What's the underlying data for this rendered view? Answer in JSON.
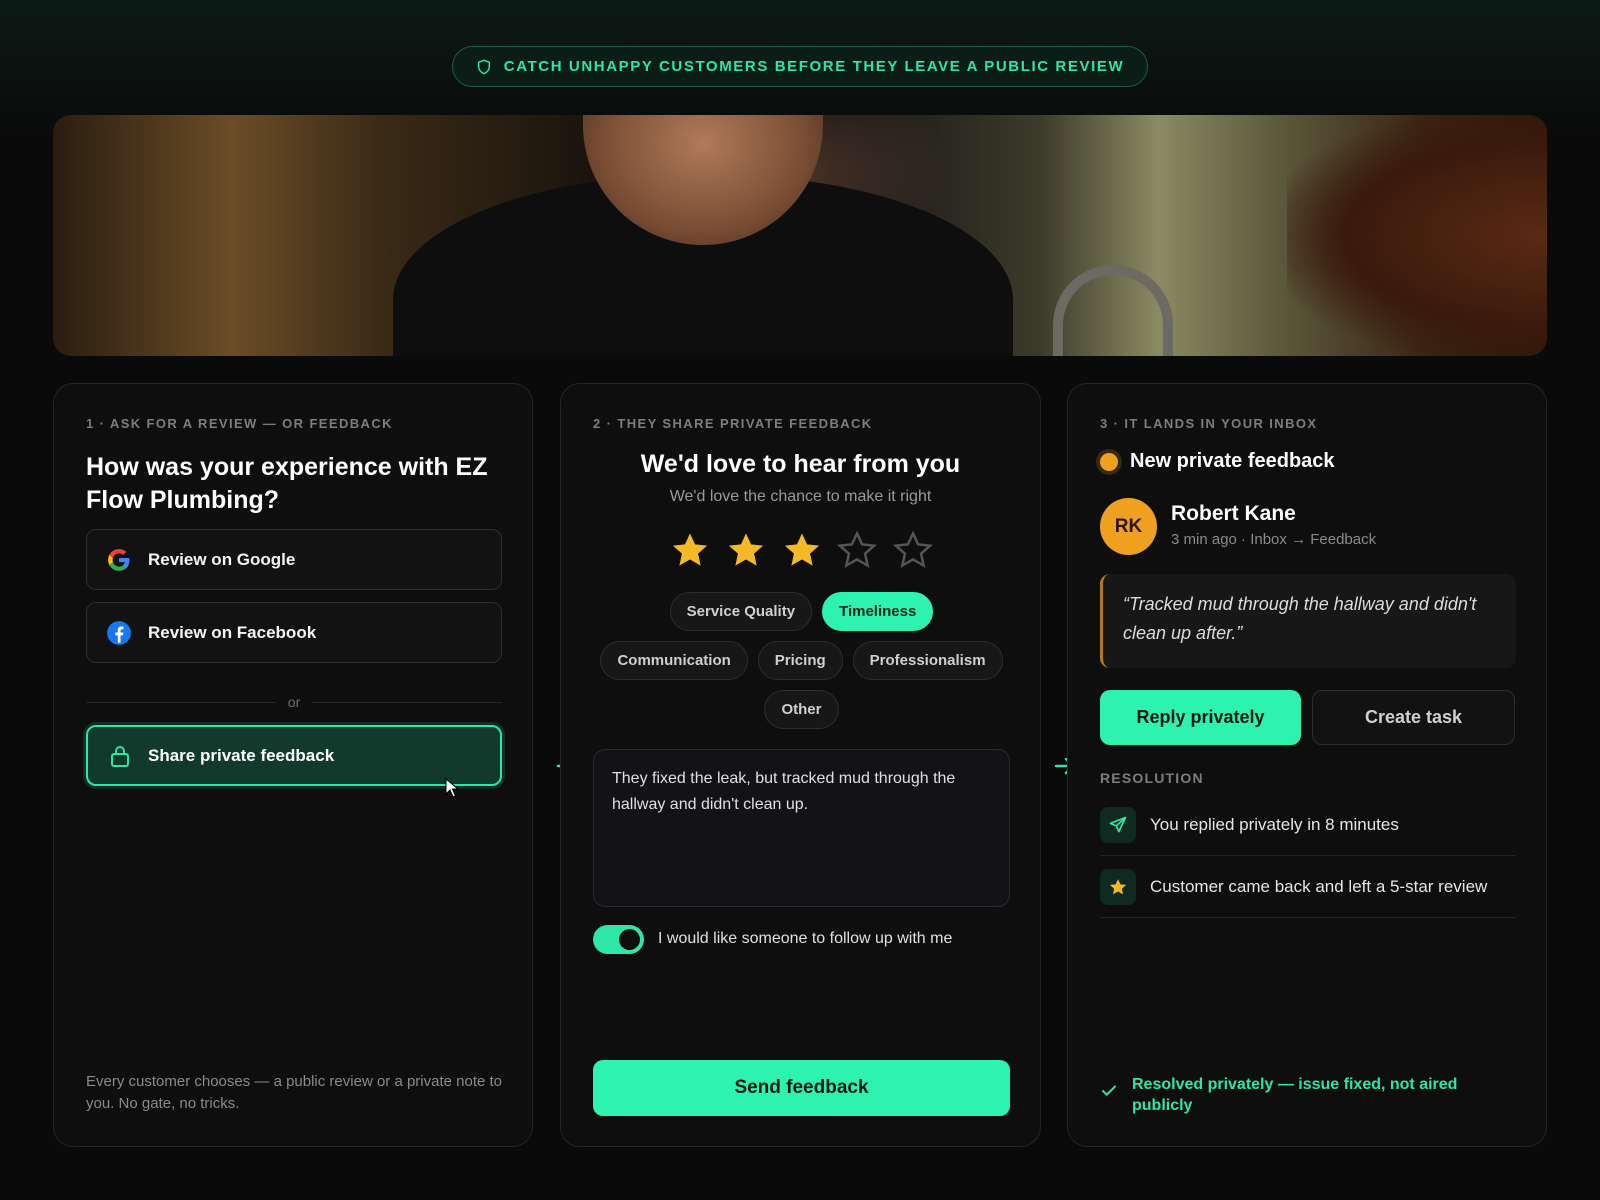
{
  "banner": {
    "text": "CATCH UNHAPPY CUSTOMERS BEFORE THEY LEAVE A PUBLIC REVIEW",
    "icon": "shield-icon"
  },
  "colors": {
    "accent": "#2ef2b0",
    "star": "#f5b826",
    "avatar": "#f0a020",
    "background": "#0a0a0a"
  },
  "step1": {
    "label": "1 · ASK FOR A REVIEW — OR FEEDBACK",
    "title": "How was your experience with EZ Flow Plumbing?",
    "google_label": "Review on Google",
    "facebook_label": "Review on Facebook",
    "or": "or",
    "share_label": "Share private feedback",
    "footnote": "Every customer chooses — a public review or a private note to you. No gate, no tricks."
  },
  "step2": {
    "label": "2 · THEY SHARE PRIVATE FEEDBACK",
    "title": "We'd love to hear from you",
    "subtitle": "We'd love the chance to make it right",
    "rating": 3,
    "rating_max": 5,
    "chips": [
      "Service Quality",
      "Timeliness",
      "Communication",
      "Pricing",
      "Professionalism",
      "Other"
    ],
    "active_chip": "Timeliness",
    "feedback_text": "They fixed the leak, but tracked mud through the hallway and didn't clean up.",
    "toggle_on": true,
    "toggle_label": "I would like someone to follow up with me",
    "send_label": "Send feedback"
  },
  "step3": {
    "label": "3 · IT LANDS IN YOUR INBOX",
    "notification": "New private feedback",
    "avatar_initials": "RK",
    "name": "Robert Kane",
    "meta": "3 min ago · Inbox → Feedback",
    "quote": "“Tracked mud through the hallway and didn't clean up after.”",
    "reply_label": "Reply privately",
    "task_label": "Create task",
    "resolution_label": "RESOLUTION",
    "resolution_items": [
      {
        "icon": "send-icon",
        "text": "You replied privately in 8 minutes"
      },
      {
        "icon": "star-icon",
        "text": "Customer came back and left a 5-star review"
      }
    ],
    "resolved_text": "Resolved privately — issue fixed, not aired publicly"
  }
}
